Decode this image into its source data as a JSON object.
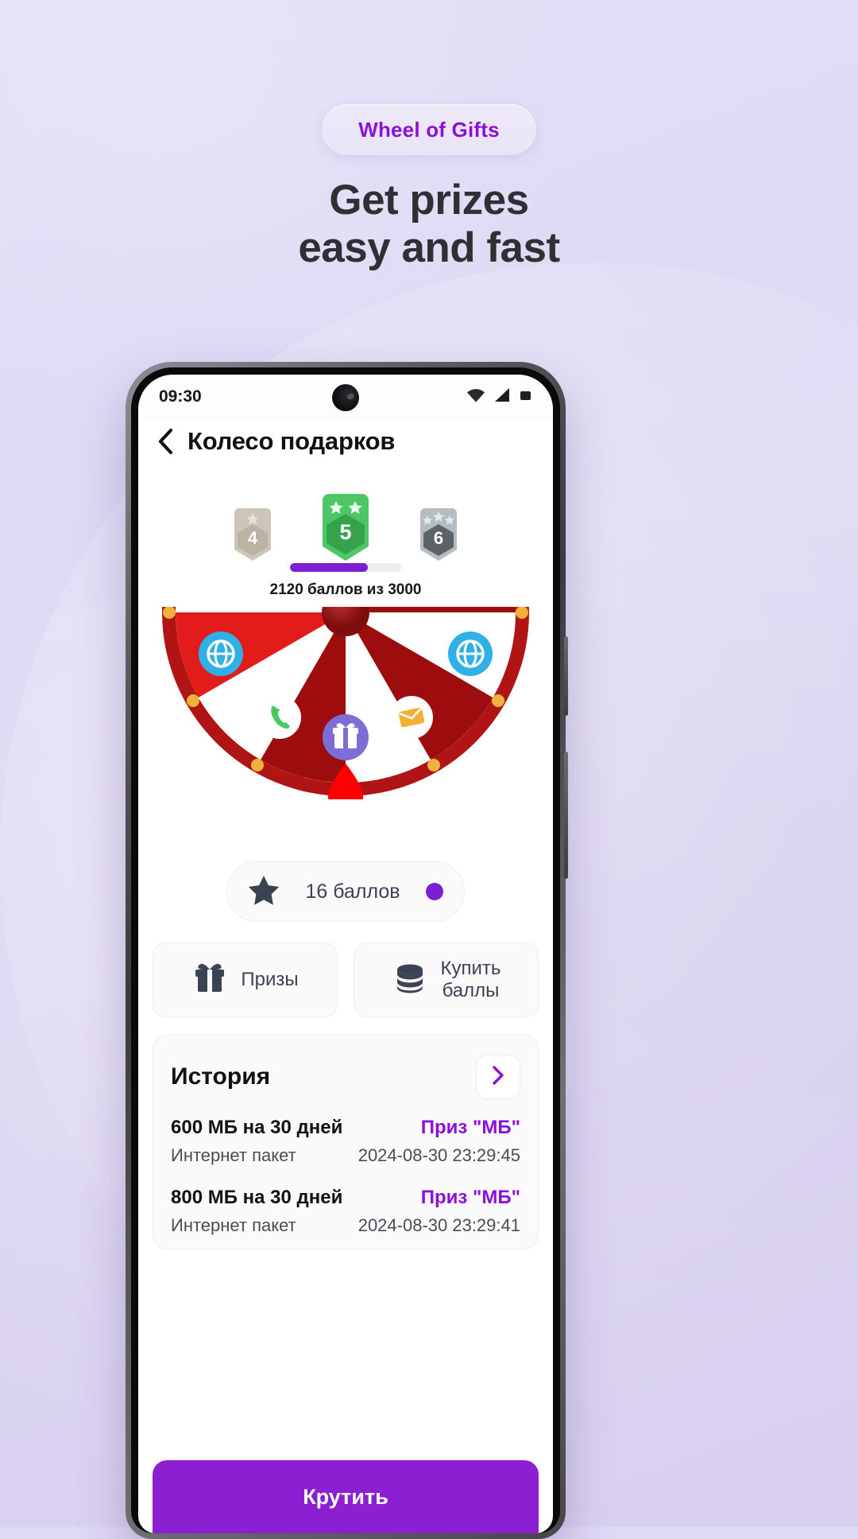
{
  "promo": {
    "pill_label": "Wheel of Gifts",
    "headline_line1": "Get prizes",
    "headline_line2": "easy and fast",
    "accent_color": "#8B10D8",
    "headline_color": "#2f3033"
  },
  "phone": {
    "status_bar": {
      "time": "09:30",
      "wifi_icon": "wifi-icon",
      "signal_icon": "signal-icon",
      "battery_icon": "battery-icon"
    },
    "app_bar": {
      "back_icon": "back-chevron-icon",
      "title": "Колесо подарков"
    },
    "levels": {
      "badges": [
        {
          "number": "4",
          "stars": 1,
          "state": "completed",
          "color": "#c9c2b4"
        },
        {
          "number": "5",
          "stars": 2,
          "state": "current",
          "color": "#4CC764"
        },
        {
          "number": "6",
          "stars": 3,
          "state": "locked",
          "color": "#9aa3a8"
        }
      ],
      "progress_percent": 70,
      "progress_color": "#7B1FD1",
      "progress_label": "2120 баллов из 3000",
      "points_current": 2120,
      "points_target": 3000
    },
    "wheel": {
      "segment_colors": [
        "#E21B1B",
        "#ffffff",
        "#9E0D0D"
      ],
      "rim_color": "#B01414",
      "pointer_color": "#FF0000",
      "hub_color": "#8E1010",
      "icons": [
        {
          "name": "globe-icon",
          "color": "#2FB1E8"
        },
        {
          "name": "phone-icon",
          "color": "#4CC764"
        },
        {
          "name": "envelope-icon",
          "color": "#F2B135"
        },
        {
          "name": "gift-icon",
          "color": "#7B6FD6"
        },
        {
          "name": "globe-icon",
          "color": "#2FB1E8"
        },
        {
          "name": "check-icon",
          "color": "#4CC764"
        }
      ]
    },
    "points_chip": {
      "star_icon": "star-icon",
      "label": "16 баллов",
      "dot_color": "#7B1FD1"
    },
    "actions": [
      {
        "icon": "gift-icon",
        "label": "Призы"
      },
      {
        "icon": "coins-stack-icon",
        "label": "Купить\nбаллы"
      }
    ],
    "history": {
      "title": "История",
      "more_icon": "chevron-right-icon",
      "rows": [
        {
          "name": "600 МБ на 30 дней",
          "prize": "Приз \"МБ\"",
          "subtitle": "Интернет пакет",
          "date": "2024-08-30 23:29:45"
        },
        {
          "name": "800 МБ на 30 дней",
          "prize": "Приз \"МБ\"",
          "subtitle": "Интернет пакет",
          "date": "2024-08-30 23:29:41"
        }
      ]
    },
    "spin_button": {
      "label": "Крутить",
      "color": "#8B1FD1"
    }
  }
}
